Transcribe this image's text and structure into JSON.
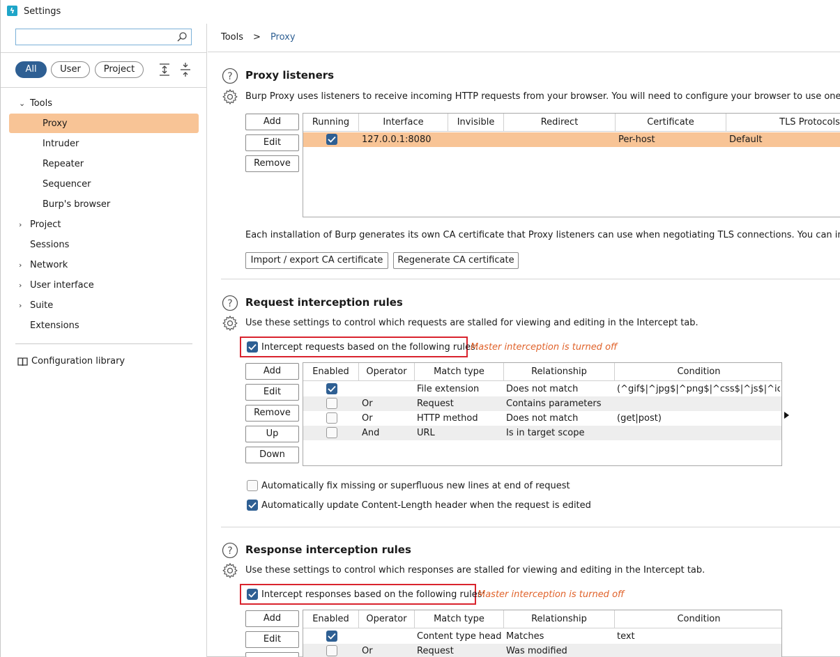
{
  "window": {
    "title": "Settings"
  },
  "sidebar": {
    "search_placeholder": "",
    "filters": [
      "All",
      "User",
      "Project"
    ],
    "tree": {
      "tools": "Tools",
      "proxy": "Proxy",
      "intruder": "Intruder",
      "repeater": "Repeater",
      "sequencer": "Sequencer",
      "burps_browser": "Burp's browser",
      "project": "Project",
      "sessions": "Sessions",
      "network": "Network",
      "user_interface": "User interface",
      "suite": "Suite",
      "extensions": "Extensions"
    },
    "config_library": "Configuration library"
  },
  "breadcrumb": {
    "parent": "Tools",
    "sep": ">",
    "current": "Proxy"
  },
  "listeners": {
    "title": "Proxy listeners",
    "description": "Burp Proxy uses listeners to receive incoming HTTP requests from your browser. You will need to configure your browser to use one of the",
    "buttons": {
      "add": "Add",
      "edit": "Edit",
      "remove": "Remove"
    },
    "columns": [
      "Running",
      "Interface",
      "Invisible",
      "Redirect",
      "Certificate",
      "TLS Protocols"
    ],
    "rows": [
      {
        "running": true,
        "interface": "127.0.0.1:8080",
        "invisible": "",
        "redirect": "",
        "certificate": "Per-host",
        "tls": "Default"
      }
    ],
    "ca_text": "Each installation of Burp generates its own CA certificate that Proxy listeners can use when negotiating TLS connections. You can import or e",
    "import_export_label": "Import / export CA certificate",
    "regenerate_label": "Regenerate CA certificate"
  },
  "request_rules": {
    "title": "Request interception rules",
    "description": "Use these settings to control which requests are stalled for viewing and editing in the Intercept tab.",
    "intercept_label": "Intercept requests based on the following rules:",
    "warning": "Master interception is turned off",
    "buttons": {
      "add": "Add",
      "edit": "Edit",
      "remove": "Remove",
      "up": "Up",
      "down": "Down"
    },
    "columns": [
      "Enabled",
      "Operator",
      "Match type",
      "Relationship",
      "Condition"
    ],
    "rows": [
      {
        "enabled": true,
        "operator": "",
        "match_type": "File extension",
        "relationship": "Does not match",
        "condition": "(^gif$|^jpg$|^png$|^css$|^js$|^ico$|..."
      },
      {
        "enabled": false,
        "operator": "Or",
        "match_type": "Request",
        "relationship": "Contains parameters",
        "condition": ""
      },
      {
        "enabled": false,
        "operator": "Or",
        "match_type": "HTTP method",
        "relationship": "Does not match",
        "condition": "(get|post)"
      },
      {
        "enabled": false,
        "operator": "And",
        "match_type": "URL",
        "relationship": "Is in target scope",
        "condition": ""
      }
    ],
    "auto_fix_label": "Automatically fix missing or superfluous new lines at end of request",
    "auto_update_label": "Automatically update Content-Length header when the request is edited"
  },
  "response_rules": {
    "title": "Response interception rules",
    "description": "Use these settings to control which responses are stalled for viewing and editing in the Intercept tab.",
    "intercept_label": "Intercept responses based on the following rules:",
    "warning": "Master interception is turned off",
    "buttons": {
      "add": "Add",
      "edit": "Edit"
    },
    "columns": [
      "Enabled",
      "Operator",
      "Match type",
      "Relationship",
      "Condition"
    ],
    "rows": [
      {
        "enabled": true,
        "operator": "",
        "match_type": "Content type head...",
        "relationship": "Matches",
        "condition": "text"
      },
      {
        "enabled": false,
        "operator": "Or",
        "match_type": "Request",
        "relationship": "Was modified",
        "condition": ""
      }
    ]
  },
  "colors": {
    "accent": "#2e5f93",
    "selection": "#f8c496",
    "warning": "#e0622a",
    "highlight_box": "#d9232d"
  }
}
